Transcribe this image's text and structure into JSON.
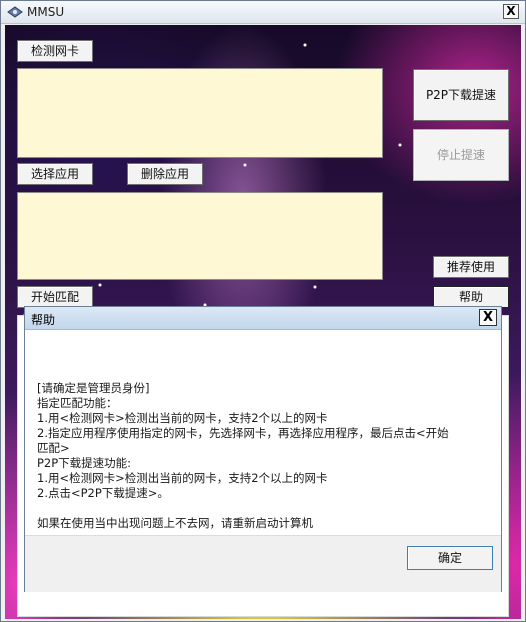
{
  "window": {
    "title": "MMSU",
    "close_label": "X"
  },
  "buttons": {
    "detect_nic": "检测网卡",
    "select_app": "选择应用",
    "delete_app": "删除应用",
    "start_match": "开始匹配",
    "p2p_accelerate": "P2P下载提速",
    "stop_accelerate": "停止提速",
    "recommend": "推荐使用",
    "help": "帮助"
  },
  "textboxes": {
    "nic_list": "",
    "app_list": ""
  },
  "help_dialog": {
    "title": "帮助",
    "close_label": "X",
    "lines": [
      "[请确定是管理员身份]",
      "指定匹配功能：",
      "1.用<检测网卡>检测出当前的网卡，支持2个以上的网卡",
      "2.指定应用程序使用指定的网卡，先选择网卡，再选择应用程序，最后点击<开始",
      "匹配>",
      "P2P下载提速功能:",
      "1.用<检测网卡>检测出当前的网卡，支持2个以上的网卡",
      "2.点击<P2P下载提速>。",
      "",
      "如果在使用当中出现问题上不去网，请重新启动计算机"
    ],
    "ok_label": "确定"
  },
  "icons": {
    "app": "network-adapter-icon",
    "close": "close-icon"
  }
}
